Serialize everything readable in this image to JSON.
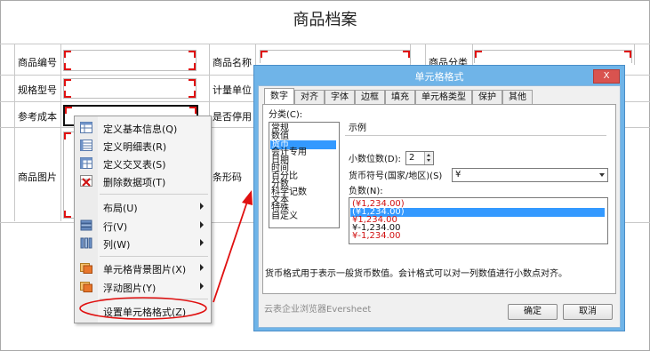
{
  "page": {
    "title": "商品档案"
  },
  "form": {
    "row1": {
      "code_label": "商品编号",
      "name_label": "商品名称",
      "category_label": "商品分类"
    },
    "row2": {
      "spec_label": "规格型号",
      "unit_label": "计量单位"
    },
    "row3": {
      "cost_label": "参考成本",
      "disabled_label": "是否停用"
    },
    "row4": {
      "image_label": "商品图片",
      "barcode_label": "条形码"
    }
  },
  "context_menu": {
    "items": [
      {
        "label": "定义基本信息(Q)",
        "icon": "table-icon"
      },
      {
        "label": "定义明细表(R)",
        "icon": "detail-table-icon"
      },
      {
        "label": "定义交叉表(S)",
        "icon": "cross-table-icon"
      },
      {
        "label": "删除数据项(T)",
        "icon": "delete-table-icon"
      },
      {
        "label": "布局(U)",
        "icon": "",
        "submenu": true
      },
      {
        "label": "行(V)",
        "icon": "rows-icon",
        "submenu": true
      },
      {
        "label": "列(W)",
        "icon": "columns-icon",
        "submenu": true
      },
      {
        "label": "单元格背景图片(X)",
        "icon": "background-image-icon",
        "submenu": true
      },
      {
        "label": "浮动图片(Y)",
        "icon": "float-image-icon",
        "submenu": true
      },
      {
        "label": "设置单元格格式(Z)",
        "icon": ""
      }
    ]
  },
  "dialog": {
    "title": "单元格格式",
    "close": "X",
    "tabs": [
      "数字",
      "对齐",
      "字体",
      "边框",
      "填充",
      "单元格类型",
      "保护",
      "其他"
    ],
    "category_label": "分类(C):",
    "categories": [
      "常规",
      "数值",
      "货币",
      "会计专用",
      "日期",
      "时间",
      "百分比",
      "分数",
      "科学记数",
      "文本",
      "特殊",
      "自定义"
    ],
    "selected_category": "货币",
    "sample_label": "示例",
    "decimal_label": "小数位数(D):",
    "decimal_value": "2",
    "currency_label": "货币符号(国家/地区)(S)",
    "currency_value": "¥",
    "negative_label": "负数(N):",
    "negatives": [
      "(¥1,234.00)",
      "(¥1,234.00)",
      "¥1,234.00",
      "¥-1,234.00",
      "¥-1,234.00"
    ],
    "negative_colors": [
      "#d01010",
      "#ffffff",
      "#d01010",
      "#111111",
      "#d01010"
    ],
    "description": "货币格式用于表示一般货币数值。会计格式可以对一列数值进行小数点对齐。",
    "footer_brand": "云表企业浏览器Eversheet",
    "ok_label": "确定",
    "cancel_label": "取消"
  },
  "colors": {
    "accent_red": "#e01010",
    "dialog_title": "#6fb4e8",
    "selection": "#3399ff"
  }
}
